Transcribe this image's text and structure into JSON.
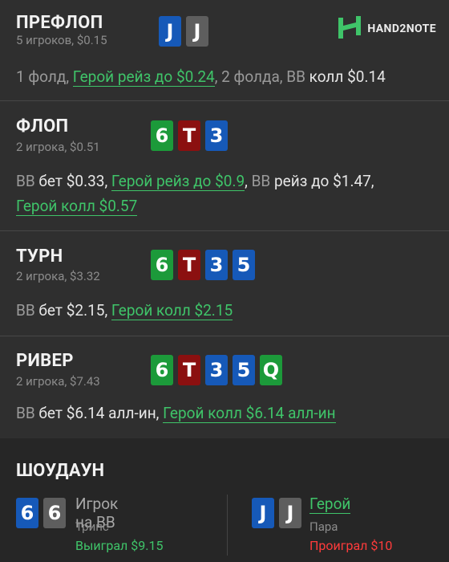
{
  "logo": {
    "text": "HAND2NOTE",
    "icon": "h2n-logo-icon",
    "color": "#3fc469"
  },
  "colors": {
    "hero": "#3fc469",
    "win": "#3fc469",
    "lose": "#ff3b3b",
    "blue_card": "#1659b8",
    "green_card": "#1c9a3a",
    "red_card": "#8b1010",
    "gray_card": "#5e5e5e"
  },
  "preflop": {
    "title": "ПРЕФЛОП",
    "sub": "5 игроков, $0.15",
    "cards": [
      {
        "rank": "J",
        "suit": "blue"
      },
      {
        "rank": "J",
        "suit": "gray"
      }
    ],
    "actions": {
      "a1": "1 фолд, ",
      "a2": "Герой рейз до $0.24",
      "a3": ", 2 фолда, ",
      "a4": "BB",
      "a5": " колл $0.14"
    }
  },
  "flop": {
    "title": "ФЛОП",
    "sub": "2 игрока, $0.51",
    "cards": [
      {
        "rank": "6",
        "suit": "green"
      },
      {
        "rank": "T",
        "suit": "red"
      },
      {
        "rank": "3",
        "suit": "blue"
      }
    ],
    "actions": {
      "a1": "BB",
      "a2": " бет $0.33, ",
      "a3": "Герой рейз до $0.9",
      "a4": ", ",
      "a5": "BB",
      "a6": " рейз до $1.47,",
      "a7": "Герой колл $0.57"
    }
  },
  "turn": {
    "title": "ТУРН",
    "sub": "2 игрока, $3.32",
    "cards": [
      {
        "rank": "6",
        "suit": "green"
      },
      {
        "rank": "T",
        "suit": "red"
      },
      {
        "rank": "3",
        "suit": "blue"
      },
      {
        "rank": "5",
        "suit": "blue"
      }
    ],
    "actions": {
      "a1": "BB",
      "a2": " бет $2.15, ",
      "a3": "Герой колл $2.15"
    }
  },
  "river": {
    "title": "РИВЕР",
    "sub": "2 игрока, $7.43",
    "cards": [
      {
        "rank": "6",
        "suit": "green"
      },
      {
        "rank": "T",
        "suit": "red"
      },
      {
        "rank": "3",
        "suit": "blue"
      },
      {
        "rank": "5",
        "suit": "blue"
      },
      {
        "rank": "Q",
        "suit": "green"
      }
    ],
    "actions": {
      "a1": "BB",
      "a2": " бет $6.14 алл-ин, ",
      "a3": "Герой колл $6.14 алл-ин"
    }
  },
  "showdown": {
    "title": "ШОУДАУН",
    "players": [
      {
        "name": "Игрок на BB",
        "hand": "Трипс",
        "result": "Выиграл $9.15",
        "cards": [
          {
            "rank": "6",
            "suit": "blue"
          },
          {
            "rank": "6",
            "suit": "gray"
          }
        ]
      },
      {
        "name": "Герой",
        "hand": "Пара",
        "result": "Проиграл $10",
        "cards": [
          {
            "rank": "J",
            "suit": "blue"
          },
          {
            "rank": "J",
            "suit": "gray"
          }
        ]
      }
    ]
  }
}
